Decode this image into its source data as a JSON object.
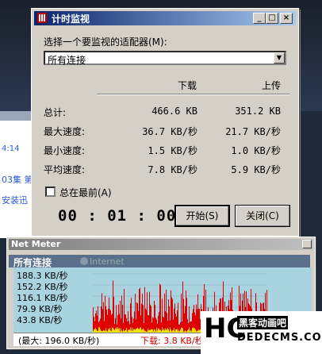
{
  "background": {
    "left_text_1": "4:14",
    "left_text_2": "03集  第",
    "left_text_3": "安装迅"
  },
  "dialog": {
    "title": "计时监视",
    "adapter_label": "选择一个要监视的适配器(M):",
    "adapter_value": "所有连接",
    "col_download": "下载",
    "col_upload": "上传",
    "rows": [
      {
        "label": "总计:",
        "down": "466.6 KB",
        "up": "351.2 KB"
      },
      {
        "label": "最大速度:",
        "down": "36.7 KB/秒",
        "up": "21.7 KB/秒"
      },
      {
        "label": "最小速度:",
        "down": "1.5 KB/秒",
        "up": "1.0 KB/秒"
      },
      {
        "label": "平均速度:",
        "down": "7.8 KB/秒",
        "up": "5.9 KB/秒"
      }
    ],
    "always_on_top_label": "总在最前(A)",
    "always_on_top_checked": false,
    "timer": "00 : 01 : 00",
    "start_label": "开始(S)",
    "close_label": "关闭(C)"
  },
  "net_meter": {
    "title": "Net Meter",
    "connection": "所有连接",
    "internet_label": "Internet",
    "y_labels": [
      "188.3 KB/秒",
      "152.2 KB/秒",
      "116.1 KB/秒",
      "79.9 KB/秒",
      "43.8 KB/秒"
    ],
    "max_text": "(最大: 196.0 KB/秒)",
    "download_text": "下载: 3.8 KB/秒",
    "colors": {
      "download": "#e00000",
      "upload": "#f0e000",
      "graph_bg": "#a9d3df"
    }
  },
  "watermark": {
    "logo": "HC",
    "line1": "黑客动画吧",
    "line2": "DEDECMS.COM"
  }
}
